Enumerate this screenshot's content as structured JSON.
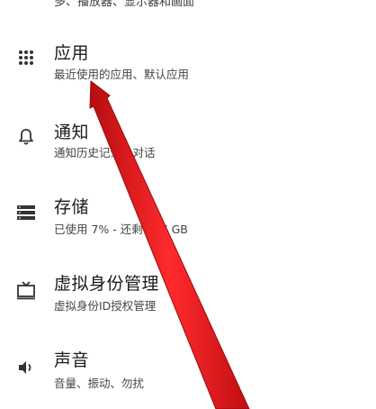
{
  "partial_top_text": "多、播放器、显示器和画面",
  "settings": {
    "items": [
      {
        "icon": "apps-grid-icon",
        "title": "应用",
        "subtitle": "最近使用的应用、默认应用"
      },
      {
        "icon": "bell-icon",
        "title": "通知",
        "subtitle": "通知历史记录、对话"
      },
      {
        "icon": "storage-icon",
        "title": "存储",
        "subtitle": "已使用 7% - 还剩 127 GB"
      },
      {
        "icon": "tv-icon",
        "title": "虚拟身份管理",
        "subtitle": "虚拟身份ID授权管理"
      },
      {
        "icon": "speaker-icon",
        "title": "声音",
        "subtitle": "音量、振动、勿扰"
      }
    ]
  },
  "annotation": {
    "arrow_color": "#e8191c"
  }
}
